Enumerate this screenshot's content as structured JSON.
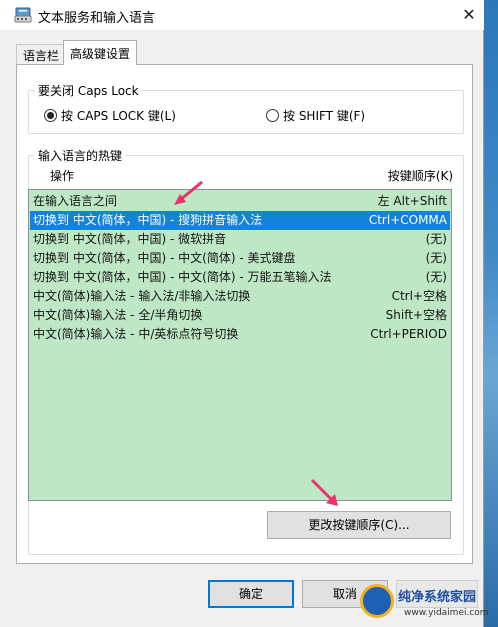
{
  "window": {
    "title": "文本服务和输入语言",
    "close_glyph": "✕"
  },
  "tabs": [
    {
      "label": "语言栏",
      "active": false
    },
    {
      "label": "高级键设置",
      "active": true
    }
  ],
  "caps_lock_group": {
    "title": "要关闭 Caps Lock",
    "options": [
      {
        "label": "按 CAPS LOCK 键(L)",
        "checked": true
      },
      {
        "label": "按 SHIFT 键(F)",
        "checked": false
      }
    ]
  },
  "hotkeys_group": {
    "title": "输入语言的热键",
    "col_action": "操作",
    "col_key": "按键顺序(K)",
    "rows": [
      {
        "action": "在输入语言之间",
        "key": "左 Alt+Shift",
        "selected": false
      },
      {
        "action": "切换到 中文(简体，中国) - 搜狗拼音输入法",
        "key": "Ctrl+COMMA",
        "selected": true
      },
      {
        "action": "切换到 中文(简体，中国) - 微软拼音",
        "key": "(无)",
        "selected": false
      },
      {
        "action": "切换到 中文(简体，中国) - 中文(简体) - 美式键盘",
        "key": "(无)",
        "selected": false
      },
      {
        "action": "切换到 中文(简体，中国) - 中文(简体) - 万能五笔输入法",
        "key": "(无)",
        "selected": false
      },
      {
        "action": "中文(简体)输入法 - 输入法/非输入法切换",
        "key": "Ctrl+空格",
        "selected": false
      },
      {
        "action": "中文(简体)输入法 - 全/半角切换",
        "key": "Shift+空格",
        "selected": false
      },
      {
        "action": "中文(简体)输入法 - 中/英标点符号切换",
        "key": "Ctrl+PERIOD",
        "selected": false
      }
    ],
    "change_button": "更改按键顺序(C)..."
  },
  "footer": {
    "ok": "确定",
    "cancel": "取消"
  },
  "watermark": {
    "name": "纯净系统家园",
    "url": "www.yidaimei.com"
  },
  "colors": {
    "list_bg": "#b9e6c2",
    "selection": "#0078d7",
    "arrow": "#e8336b"
  }
}
